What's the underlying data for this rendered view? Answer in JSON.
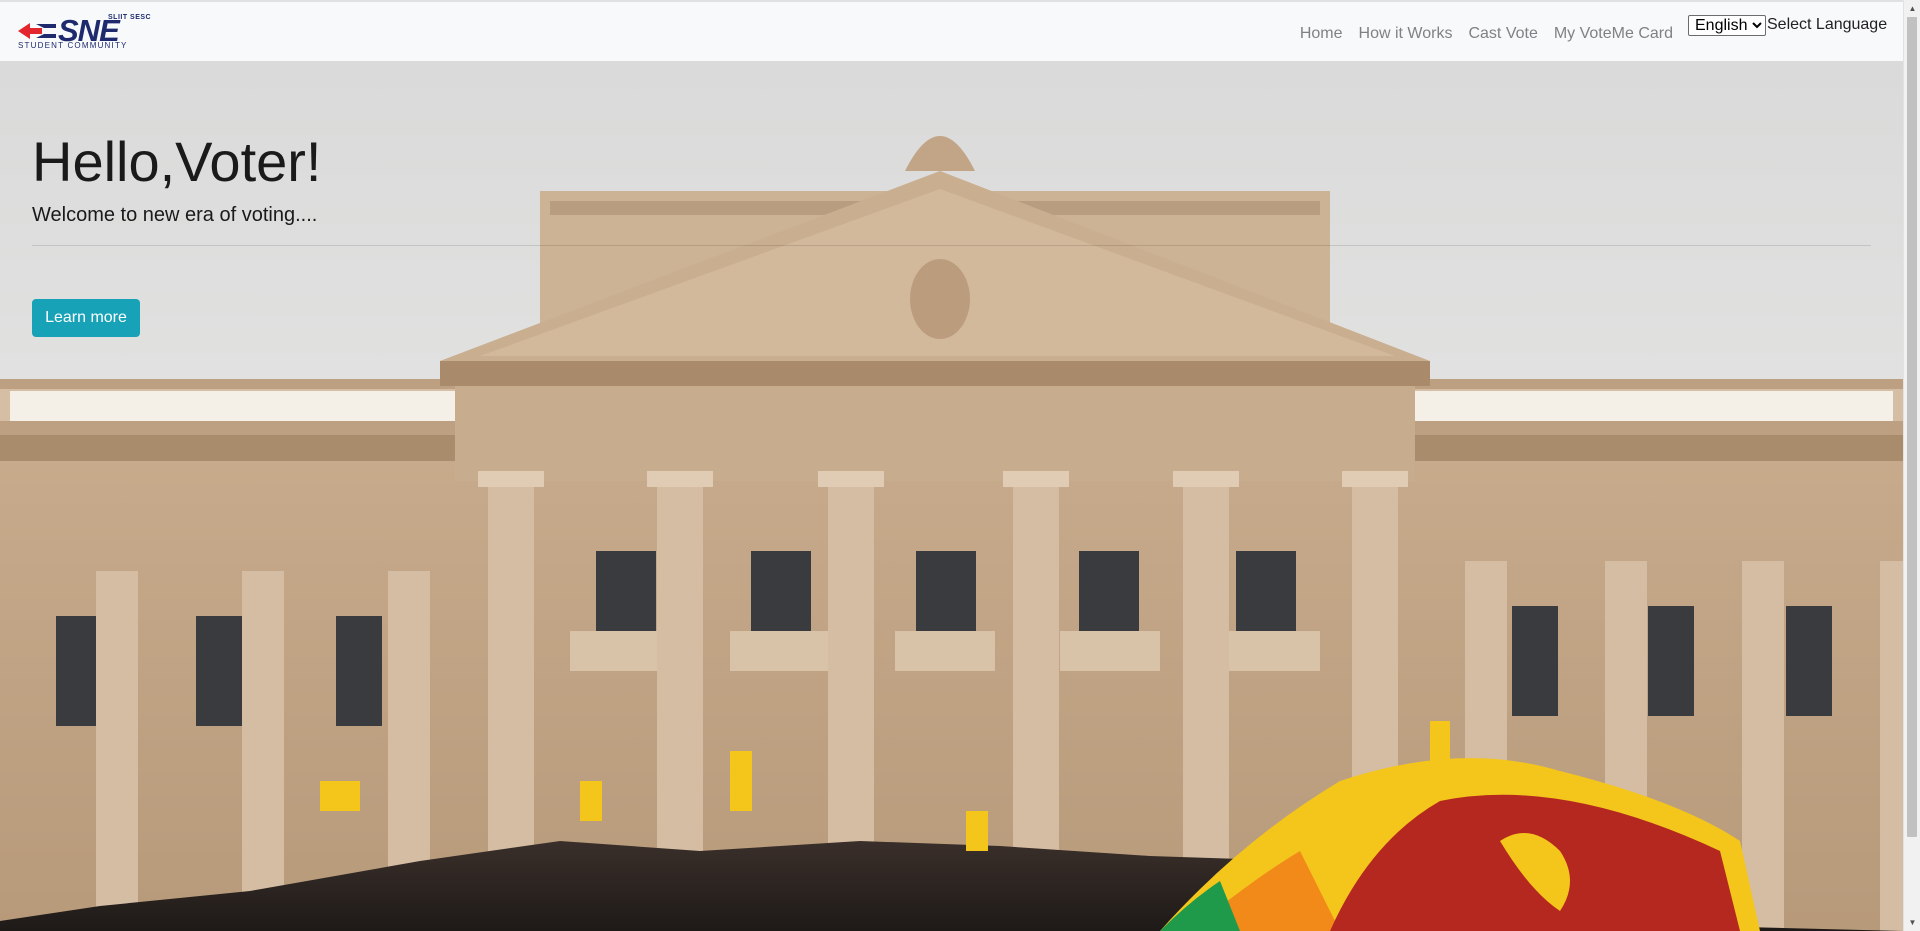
{
  "brand": {
    "logo_top": "SLIIT SESC",
    "logo_text": "SNE",
    "logo_sub": "STUDENT COMMUNITY"
  },
  "nav": {
    "links": [
      "Home",
      "How it Works",
      "Cast Vote",
      "My VoteMe Card"
    ]
  },
  "language": {
    "selected": "English",
    "label": "Select Language"
  },
  "hero": {
    "title": "Hello,Voter!",
    "lead": "Welcome to new era of voting....",
    "button": "Learn more",
    "image_description_icon": "parliament-building-image"
  },
  "colors": {
    "accent": "#17a2b8",
    "navbar_bg": "#f8f9fa",
    "nav_link": "#7f8284",
    "flag_maroon": "#b5281f",
    "flag_yellow": "#f4c51b",
    "flag_orange": "#f28a1a",
    "flag_green": "#1f9a4a"
  }
}
